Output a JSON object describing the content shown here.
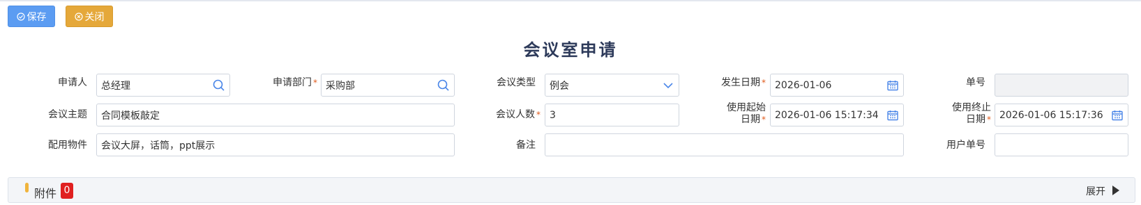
{
  "toolbar": {
    "save_label": "保存",
    "close_label": "关闭"
  },
  "page": {
    "title": "会议室申请"
  },
  "form": {
    "applicant": {
      "label": "申请人",
      "value": "总经理"
    },
    "dept": {
      "label": "申请部门",
      "value": "采购部"
    },
    "meeting_type": {
      "label": "会议类型",
      "value": "例会"
    },
    "date": {
      "label": "发生日期",
      "value": "2026-01-06"
    },
    "doc_no": {
      "label": "单号",
      "value": ""
    },
    "subject": {
      "label": "会议主题",
      "value": "合同模板敲定"
    },
    "attendees": {
      "label": "会议人数",
      "value": "3"
    },
    "start": {
      "label_line1": "使用起始",
      "label_line2": "日期",
      "value": "2026-01-06 15:17:34"
    },
    "end": {
      "label_line1": "使用终止",
      "label_line2": "日期",
      "value": "2026-01-06 15:17:36"
    },
    "items": {
      "label": "配用物件",
      "value": "会议大屏，话筒，ppt展示"
    },
    "remark": {
      "label": "备注",
      "value": ""
    },
    "user_no": {
      "label": "用户单号",
      "value": ""
    },
    "required_mark": "*"
  },
  "attachments": {
    "label": "附件",
    "count": "0",
    "expand_label": "展开"
  },
  "colors": {
    "save_button": "#5b9cf2",
    "close_button": "#e5a83a",
    "title": "#2d3a5a",
    "badge": "#e02020",
    "required": "#e05a1c"
  }
}
